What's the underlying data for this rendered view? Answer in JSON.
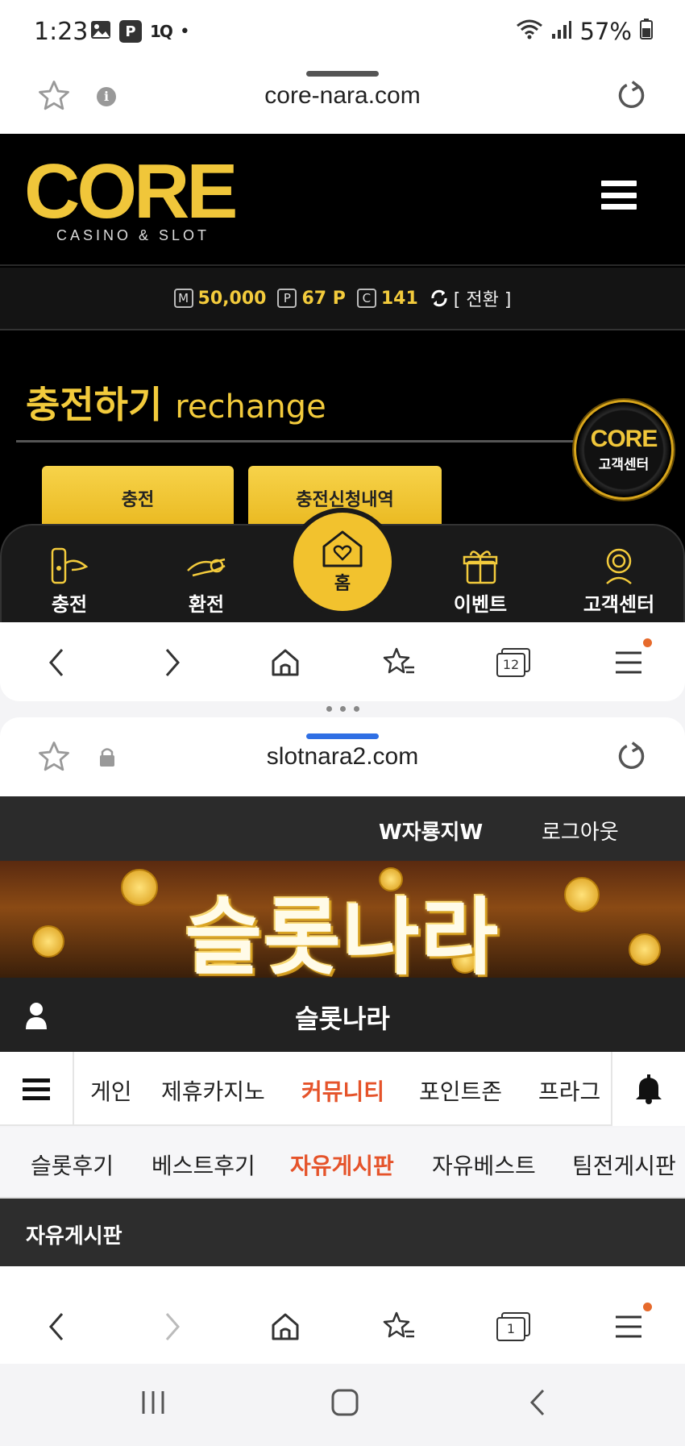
{
  "status_bar": {
    "time": "1:23",
    "p_badge": "P",
    "one_badge": "1Q",
    "battery": "57%"
  },
  "browser_top": {
    "url": "core-nara.com"
  },
  "core": {
    "logo": "CORE",
    "logo_sub": "CASINO & SLOT",
    "balances": [
      {
        "tag": "M",
        "value": "50,000"
      },
      {
        "tag": "P",
        "value": "67 P"
      },
      {
        "tag": "C",
        "value": "141"
      }
    ],
    "convert_label": "[ 전환 ]",
    "recharge_title": "충전하기",
    "recharge_title_en": "rechange",
    "btn_charge": "충전",
    "btn_history": "충전신청내역",
    "cs_badge_logo": "CORE",
    "cs_badge_label": "고객센터",
    "nav": {
      "charge": "충전",
      "exchange": "환전",
      "home": "홈",
      "event": "이벤트",
      "support": "고객센터"
    }
  },
  "browser_bottom_top": {
    "tab_count": "12"
  },
  "browser_second": {
    "url": "slotnara2.com"
  },
  "slotnara": {
    "username": "W자룡지W",
    "logout": "로그아웃",
    "banner_title": "슬롯나라",
    "site_title": "슬롯나라",
    "categories": [
      "게인",
      "제휴카지노",
      "커뮤니티",
      "포인트존",
      "프라그"
    ],
    "active_category": "커뮤니티",
    "subcategories": [
      "슬롯후기",
      "베스트후기",
      "자유게시판",
      "자유베스트",
      "팀전게시판"
    ],
    "active_subcategory": "자유게시판",
    "board_title": "자유게시판",
    "accent_color": "#e5532a"
  },
  "browser_bottom_second": {
    "tab_count": "1"
  },
  "colors": {
    "gold": "#f3cb3c",
    "notify_dot": "#e66a2c",
    "url_handle_active": "#2f6fe4"
  }
}
